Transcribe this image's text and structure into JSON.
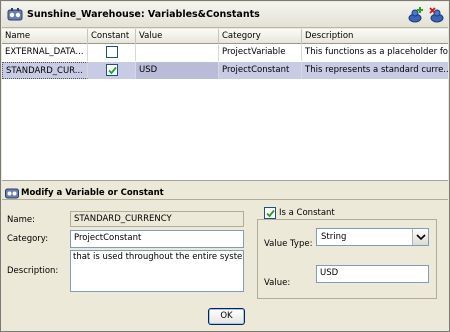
{
  "window": {
    "title": "Sunshine_Warehouse: Variables&Constants",
    "title_icon": "variables-icon",
    "add_button_icon": "add-variable-icon",
    "delete_button_icon": "delete-variable-icon"
  },
  "table": {
    "columns": [
      "Name",
      "Constant",
      "Value",
      "Category",
      "Description"
    ],
    "rows": [
      {
        "name": "EXTERNAL_DATA...",
        "constant": false,
        "value": "",
        "category": "ProjectVariable",
        "description": "This functions as a placeholder fo..."
      },
      {
        "name": "STANDARD_CUR...",
        "constant": true,
        "value": "USD",
        "category": "ProjectConstant",
        "description": "This represents a standard curre..."
      }
    ],
    "selected_row": 1
  },
  "editor": {
    "heading": "Modify a Variable or Constant",
    "heading_icon": "variable-edit-icon",
    "name_label": "Name:",
    "name_value": "STANDARD_CURRENCY",
    "category_label": "Category:",
    "category_value": "ProjectConstant",
    "description_label": "Description:",
    "description_value": " that is used throughout the entire system.",
    "is_constant_label": "Is a Constant",
    "is_constant": true,
    "value_type_label": "Value Type:",
    "value_type_selected": "String",
    "value_label": "Value:",
    "value_value": "USD"
  },
  "footer": {
    "ok_label": "OK"
  },
  "colors": {
    "selected_row": "#c7cbe4",
    "checkbox_border": "#1c5180",
    "check_mark": "#21a121",
    "dialog_bg": "#ece9d8"
  }
}
